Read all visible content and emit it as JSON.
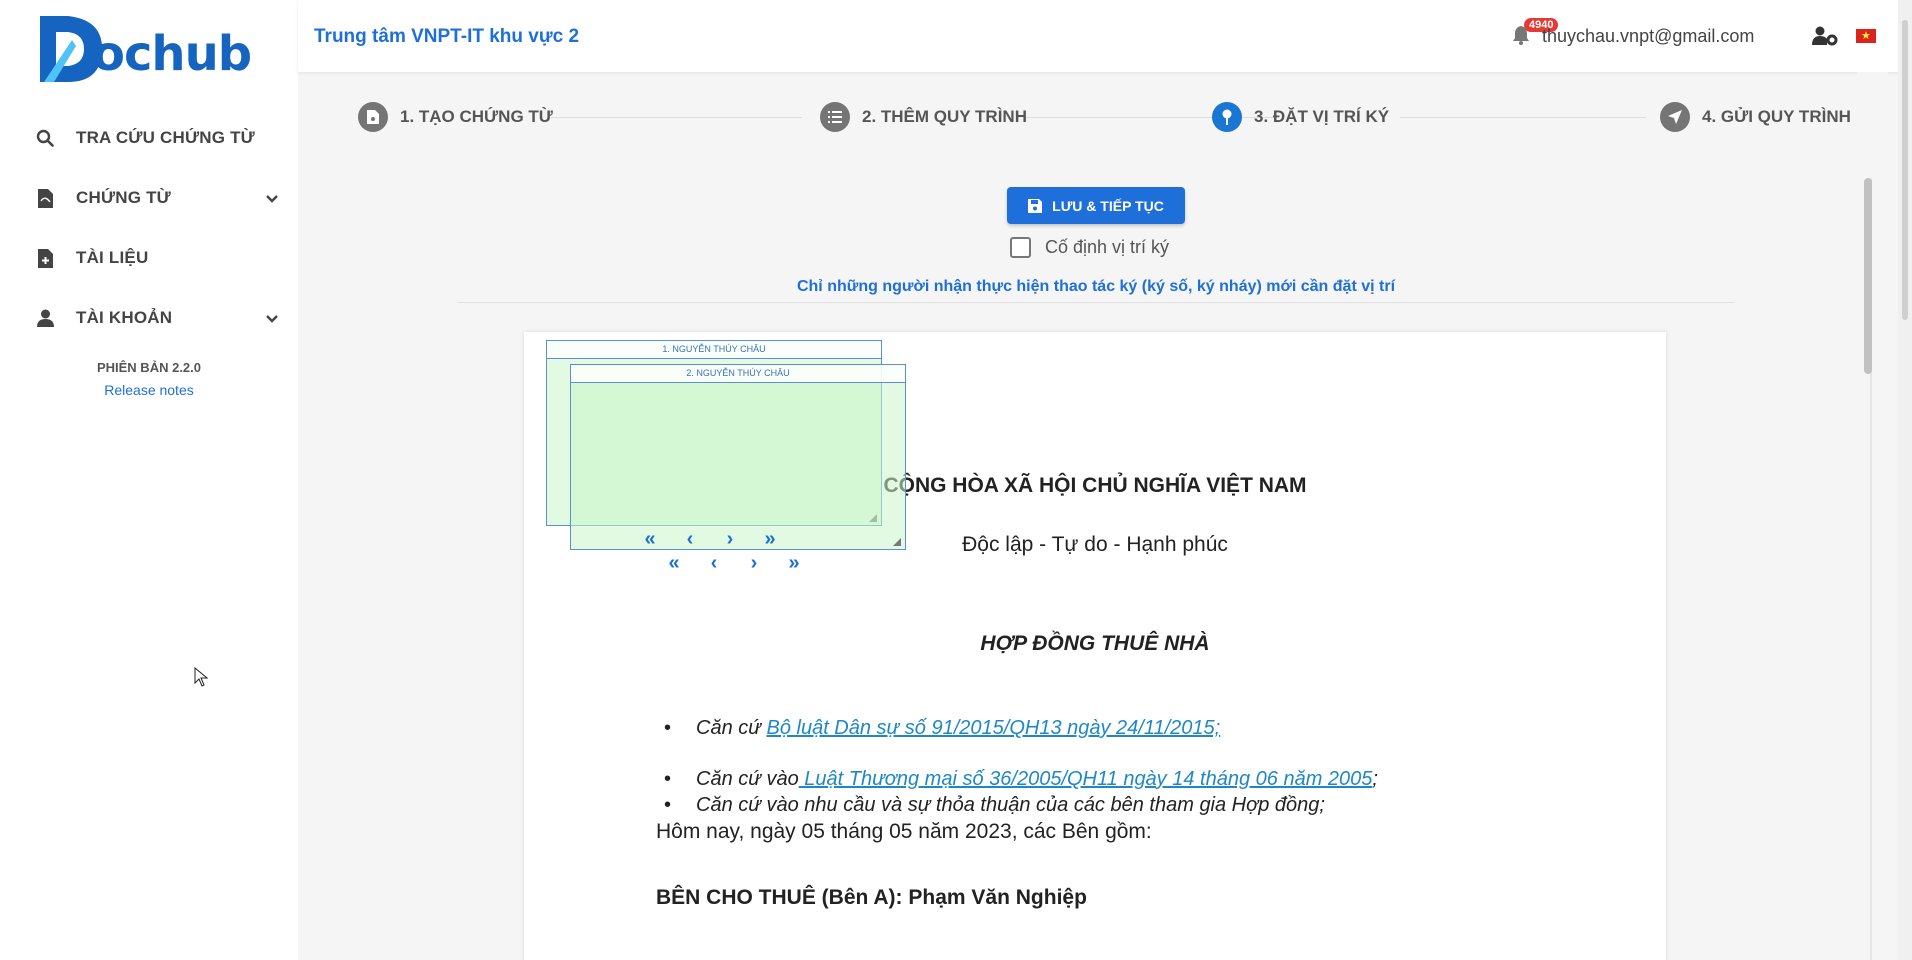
{
  "brand": {
    "logo_text": "ochub",
    "accent": "#1e6fd9"
  },
  "sidebar": {
    "items": [
      {
        "label": "TRA CỨU CHỨNG TỪ",
        "icon": "search-icon"
      },
      {
        "label": "CHỨNG TỪ",
        "icon": "file-pdf-icon",
        "expandable": true
      },
      {
        "label": "TÀI LIỆU",
        "icon": "file-plus-icon"
      },
      {
        "label": "TÀI KHOẢN",
        "icon": "user-icon",
        "expandable": true
      }
    ],
    "version": "PHIÊN BẢN 2.2.0",
    "release_notes": "Release notes"
  },
  "header": {
    "org": "Trung tâm VNPT-IT khu vực 2",
    "notification_count": "4940",
    "email": "thuychau.vnpt@gmail.com",
    "flag": "★"
  },
  "stepper": {
    "steps": [
      {
        "label": "1. TẠO CHỨNG TỪ",
        "icon": "file-icon"
      },
      {
        "label": "2. THÊM QUY TRÌNH",
        "icon": "list-icon"
      },
      {
        "label": "3. ĐẶT VỊ TRÍ KÝ",
        "icon": "pin-icon",
        "active": true
      },
      {
        "label": "4. GỬI QUY TRÌNH",
        "icon": "send-icon"
      }
    ]
  },
  "toolbar": {
    "save_label": "LƯU & TIẾP TỤC",
    "fix_position_label": "Cố định vị trí ký",
    "note": "Chỉ những người nhận thực hiện thao tác ký (ký số, ký nháy) mới cần đặt vị trí"
  },
  "signatures": [
    {
      "label": "1. NGUYỄN THÚY CHÂU"
    },
    {
      "label": "2. NGUYỄN THÚY CHÂU"
    }
  ],
  "sig_nav": [
    "«",
    "‹",
    "›",
    "»"
  ],
  "document": {
    "title": "CỘNG HÒA XÃ HỘI CHỦ NGHĨA VIỆT NAM",
    "subtitle": "Độc lập - Tự do - Hạnh phúc",
    "heading": "HỢP ĐỒNG THUÊ NHÀ",
    "bullets": [
      {
        "prefix": "Căn cứ ",
        "link": "Bộ luật Dân sự số 91/2015/QH13 ngày 24/11/2015;",
        "suffix": ""
      },
      {
        "prefix": "Căn cứ vào",
        "link": " Luật Thương mại số 36/2005/QH11 ngày 14 tháng 06 năm 2005",
        "suffix": ";"
      },
      {
        "prefix": "Căn cứ vào nhu cầu và sự thỏa thuận của các bên tham gia Hợp đồng;",
        "link": "",
        "suffix": ""
      }
    ],
    "paragraph": "Hôm nay, ngày 05 tháng 05 năm 2023, các Bên gồm:",
    "party": "BÊN CHO THUÊ (Bên A): Phạm Văn Nghiệp"
  }
}
